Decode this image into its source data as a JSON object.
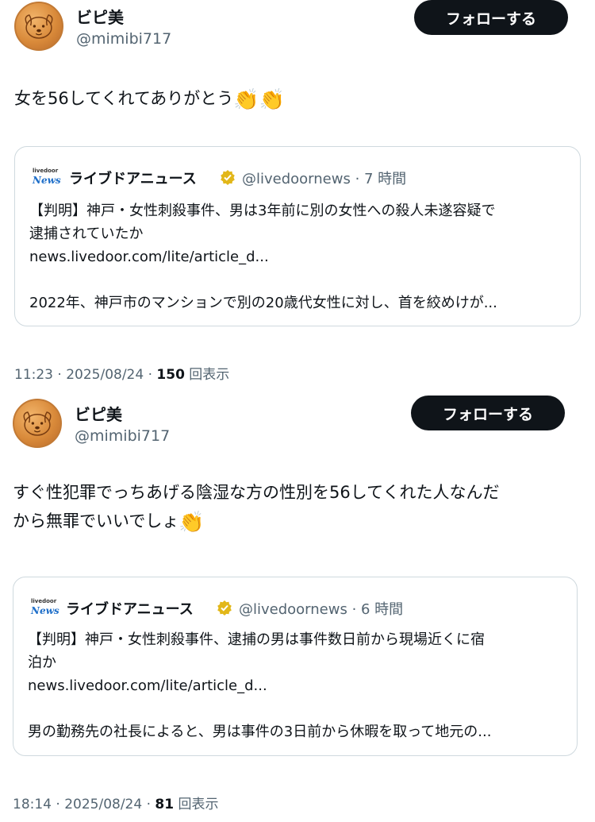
{
  "posts": [
    {
      "display_name": "ビピ美",
      "handle": "@mimibi717",
      "follow_label": "フォローする",
      "text": "女を56してくれてありがとう",
      "emojis": [
        "👏",
        "👏"
      ],
      "quote": {
        "logo_top": "livedoor",
        "logo_bottom": "News",
        "name": "ライブドアニュース",
        "verified_icon": "gold-verified-badge",
        "handle_time": "@livedoornews · 7 時間",
        "text": "【判明】神戸・女性刺殺事件、男は3年前に別の女性への殺人未遂容疑で\n逮捕されていたか\nnews.livedoor.com/lite/article_d...\n\n2022年、神戸市のマンションで別の20歳代女性に対し、首を絞めけが..."
      },
      "meta_time": "11:23 · 2025/08/24 · ",
      "views_count": "150",
      "views_label": " 回表示"
    },
    {
      "display_name": "ビピ美",
      "handle": "@mimibi717",
      "follow_label": "フォローする",
      "text": "すぐ性犯罪でっちあげる陰湿な方の性別を56してくれた人なんだ\nから無罪でいいでしょ",
      "emojis": [
        "👏"
      ],
      "quote": {
        "logo_top": "livedoor",
        "logo_bottom": "News",
        "name": "ライブドアニュース",
        "verified_icon": "gold-verified-badge",
        "handle_time": "@livedoornews · 6 時間",
        "text": "【判明】神戸・女性刺殺事件、逮捕の男は事件数日前から現場近くに宿\n泊か\nnews.livedoor.com/lite/article_d...\n\n男の勤務先の社長によると、男は事件の3日前から休暇を取って地元の..."
      },
      "meta_time": "18:14 · 2025/08/24 · ",
      "views_count": "81",
      "views_label": " 回表示"
    }
  ]
}
